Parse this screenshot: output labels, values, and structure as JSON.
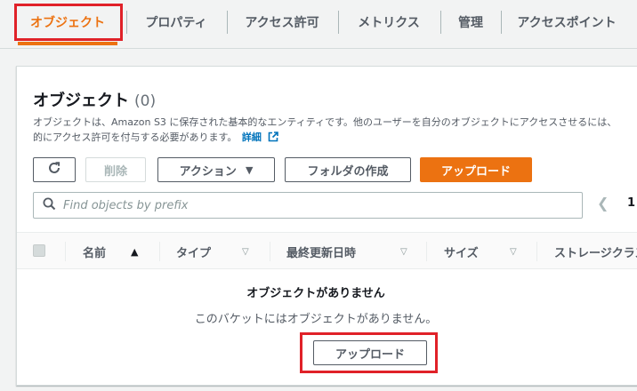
{
  "tabs": [
    {
      "label": "オブジェクト",
      "active": true
    },
    {
      "label": "プロパティ"
    },
    {
      "label": "アクセス許可"
    },
    {
      "label": "メトリクス"
    },
    {
      "label": "管理"
    },
    {
      "label": "アクセスポイント"
    }
  ],
  "panel": {
    "title": "オブジェクト",
    "count": "(0)",
    "description_line1": "オブジェクトは、Amazon S3 に保存された基本的なエンティティです。他のユーザーを自分のオブジェクトにアクセスさせるには、",
    "description_line2": "的にアクセス許可を付与する必要があります。",
    "learn_more": "詳細"
  },
  "toolbar": {
    "refresh_icon": "refresh-icon",
    "delete_label": "削除",
    "actions_label": "アクション",
    "create_folder_label": "フォルダの作成",
    "upload_label": "アップロード"
  },
  "search": {
    "placeholder": "Find objects by prefix",
    "value": ""
  },
  "pagination": {
    "page": "1"
  },
  "table": {
    "columns": [
      "名前",
      "タイプ",
      "最終更新日時",
      "サイズ",
      "ストレージクラス"
    ]
  },
  "empty_state": {
    "title": "オブジェクトがありません",
    "description": "このバケットにはオブジェクトがありません。",
    "button_label": "アップロード"
  },
  "colors": {
    "accent": "#ec7211",
    "highlight_box": "#e02128",
    "link": "#0073bb"
  }
}
